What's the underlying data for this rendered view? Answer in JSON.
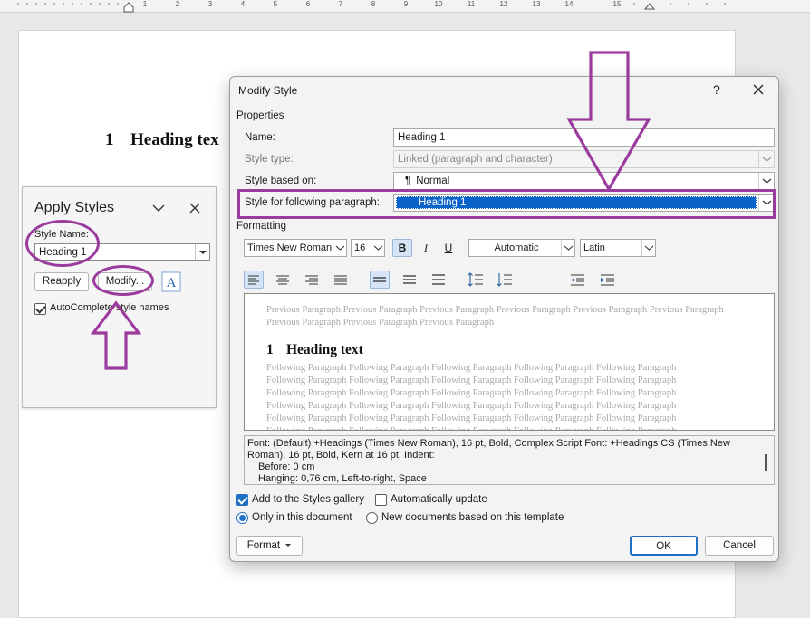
{
  "ruler": {
    "numbers": [
      "1",
      "2",
      "3",
      "4",
      "5",
      "6",
      "7",
      "8",
      "9",
      "10",
      "11",
      "12",
      "13",
      "14",
      "15"
    ]
  },
  "document": {
    "heading_number": "1",
    "heading_text": "Heading tex"
  },
  "apply_styles": {
    "title": "Apply Styles",
    "style_name_label": "Style Name:",
    "style_name_value": "Heading 1",
    "reapply_label": "Reapply",
    "modify_label": "Modify...",
    "styles_icon_glyph": "A",
    "autocomplete_label": "AutoComplete style names",
    "autocomplete_checked": true
  },
  "dialog": {
    "title": "Modify Style",
    "help_glyph": "?",
    "properties_label": "Properties",
    "name_label": "Name:",
    "name_value": "Heading 1",
    "style_type_label": "Style type:",
    "style_type_value": "Linked (paragraph and character)",
    "based_on_label": "Style based on:",
    "based_on_value": "Normal",
    "based_on_glyph": "¶",
    "following_label": "Style for following paragraph:",
    "following_value": "Heading 1",
    "formatting_label": "Formatting",
    "font_value": "Times New Roman",
    "size_value": "16",
    "bold_glyph": "B",
    "italic_glyph": "I",
    "underline_glyph": "U",
    "color_value": "Automatic",
    "script_value": "Latin",
    "preview": {
      "previous_text": "Previous Paragraph Previous Paragraph Previous Paragraph Previous Paragraph Previous Paragraph Previous Paragraph Previous Paragraph Previous Paragraph Previous Paragraph",
      "heading_number": "1",
      "heading_text": "Heading text",
      "following_line": "Following Paragraph Following Paragraph Following Paragraph Following Paragraph Following Paragraph"
    },
    "description": {
      "line1": "Font: (Default) +Headings (Times New Roman), 16 pt, Bold, Complex Script Font: +Headings CS (Times New",
      "line2": "Roman), 16 pt, Bold, Kern at 16 pt, Indent:",
      "line3": "Before:  0 cm",
      "line4": "Hanging:  0,76 cm, Left-to-right, Space"
    },
    "add_to_gallery_label": "Add to the Styles gallery",
    "add_to_gallery_checked": true,
    "auto_update_label": "Automatically update",
    "auto_update_checked": false,
    "only_this_doc_label": "Only in this document",
    "new_docs_label": "New documents based on this template",
    "format_label": "Format",
    "ok_label": "OK",
    "cancel_label": "Cancel"
  },
  "colors": {
    "annotation_purple": "#9b3b9e",
    "selection_blue": "#0a63c9",
    "accent_blue": "#1f6fc5"
  }
}
